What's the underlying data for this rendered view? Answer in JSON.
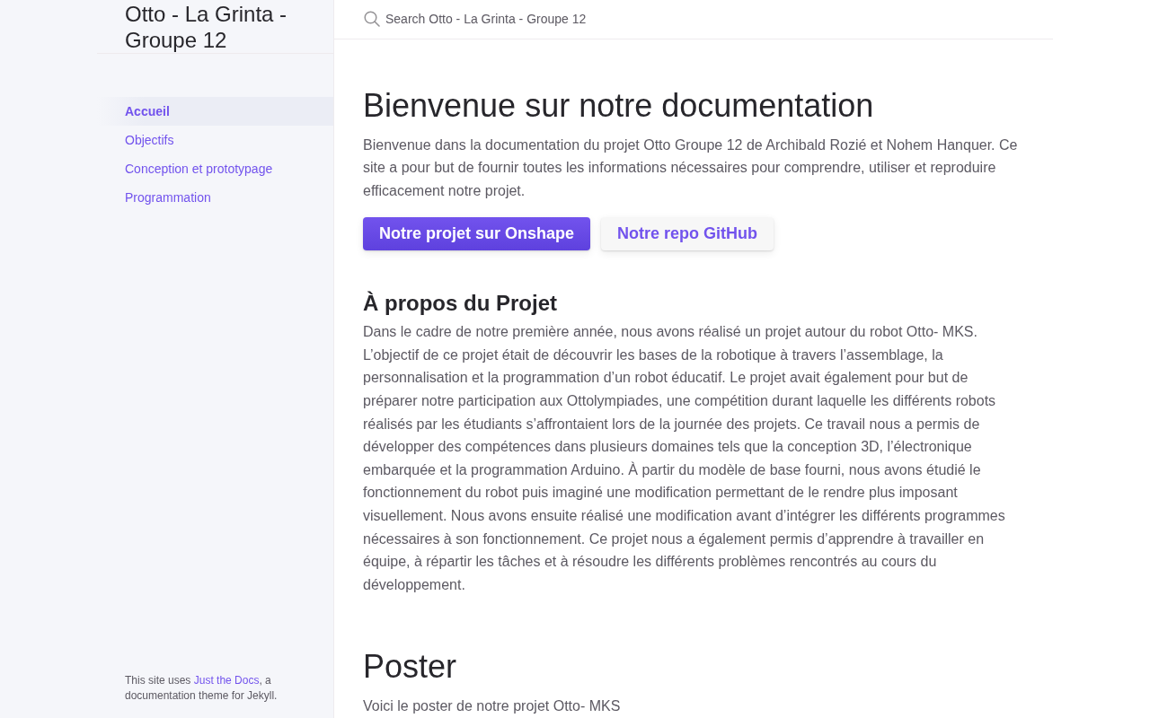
{
  "site_title": "Otto - La Grinta - Groupe 12",
  "search": {
    "placeholder": "Search Otto - La Grinta - Groupe 12"
  },
  "nav": {
    "items": [
      {
        "label": "Accueil",
        "selected": true
      },
      {
        "label": "Objectifs",
        "selected": false
      },
      {
        "label": "Conception et prototypage",
        "selected": false
      },
      {
        "label": "Programmation",
        "selected": false
      }
    ]
  },
  "footer": {
    "text_before": "This site uses ",
    "link": "Just the Docs",
    "text_after": ", a documentation theme for Jekyll."
  },
  "content": [
    {
      "kind": "heading1",
      "text": "Bienvenue sur notre documentation"
    },
    {
      "kind": "paragraph",
      "text": "Bienvenue dans la documentation du projet Otto Groupe 12 de Archibald Rozié et Nohem Hanquer. Ce site a pour but de fournir toutes les informations nécessaires pour comprendre, utiliser et reproduire efficacement notre projet."
    },
    {
      "kind": "buttons",
      "buttons": [
        {
          "label": "Notre projet sur Onshape",
          "kind": "primary"
        },
        {
          "label": "Notre repo GitHub",
          "kind": "secondary"
        }
      ]
    },
    {
      "kind": "heading2",
      "text": "À propos du Projet"
    },
    {
      "kind": "paragraph",
      "text": "Dans le cadre de notre première année, nous avons réalisé un projet autour du robot Otto- MKS. L’objectif de ce projet était de découvrir les bases de la robotique à travers l’assemblage, la personnalisation et la programmation d’un robot éducatif. Le projet avait également pour but de préparer notre participation aux Ottolympiades, une compétition durant laquelle les différents robots réalisés par les étudiants s’affrontaient lors de la journée des projets. Ce travail nous a permis de développer des compétences dans plusieurs domaines tels que la conception 3D, l’électronique embarquée et la programmation Arduino. À partir du modèle de base fourni, nous avons étudié le fonctionnement du robot puis imaginé une modification permettant de le rendre plus imposant visuellement. Nous avons ensuite réalisé une modification avant d’intégrer les différents programmes nécessaires à son fonctionnement. Ce projet nous a également permis d’apprendre à travailler en équipe, à répartir les tâches et à résoudre les différents problèmes rencontrés au cours du développement."
    },
    {
      "kind": "heading1",
      "text": "Poster"
    },
    {
      "kind": "paragraph",
      "text": "Voici le poster de notre projet Otto- MKS"
    }
  ]
}
